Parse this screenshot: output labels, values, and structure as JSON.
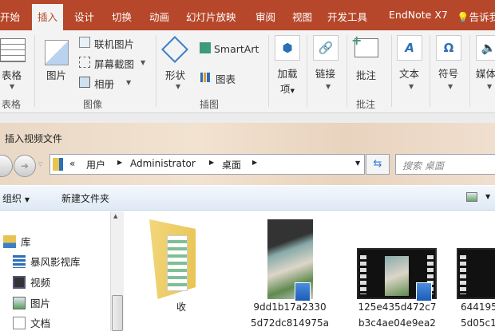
{
  "ribbon": {
    "tabs": [
      "开始",
      "插入",
      "设计",
      "切换",
      "动画",
      "幻灯片放映",
      "审阅",
      "视图",
      "开发工具",
      "EndNote X7",
      "告诉我"
    ],
    "active_tab": "插入",
    "buttons": {
      "table": "表格",
      "picture": "图片",
      "online_picture": "联机图片",
      "screenshot": "屏幕截图",
      "album": "相册",
      "shapes": "形状",
      "smartart": "SmartArt",
      "chart": "图表",
      "addins": "加载项",
      "addins_line1": "加载",
      "addins_line2": "项",
      "link": "链接",
      "comment": "批注",
      "text": "文本",
      "symbol": "符号",
      "media": "媒体"
    },
    "groups": {
      "tables": "表格",
      "images": "图像",
      "illustrations": "插图",
      "comments": "批注"
    }
  },
  "dialog": {
    "title": "插入视频文件",
    "breadcrumb": [
      "用户",
      "Administrator",
      "桌面"
    ],
    "breadcrumb_prefix": "«",
    "search_placeholder": "搜索 桌面",
    "toolbar": {
      "organize": "组织",
      "new_folder": "新建文件夹"
    },
    "nav": [
      {
        "label": "库",
        "icon": "library-icon"
      },
      {
        "label": "暴风影视库",
        "icon": "video-library-icon"
      },
      {
        "label": "视频",
        "icon": "video-icon"
      },
      {
        "label": "图片",
        "icon": "pictures-icon"
      },
      {
        "label": "文档",
        "icon": "documents-icon"
      }
    ],
    "files": [
      {
        "line1": "收",
        "line2": "",
        "type": "folder"
      },
      {
        "line1": "9dd1b17a2330",
        "line2": "5d72dc814975a",
        "type": "video"
      },
      {
        "line1": "125e435d472c7",
        "line2": "b3c4ae04e9ea2",
        "type": "video"
      },
      {
        "line1": "644195",
        "line2": "5d05c1",
        "type": "video"
      }
    ]
  },
  "colors": {
    "accent": "#b7472a"
  }
}
